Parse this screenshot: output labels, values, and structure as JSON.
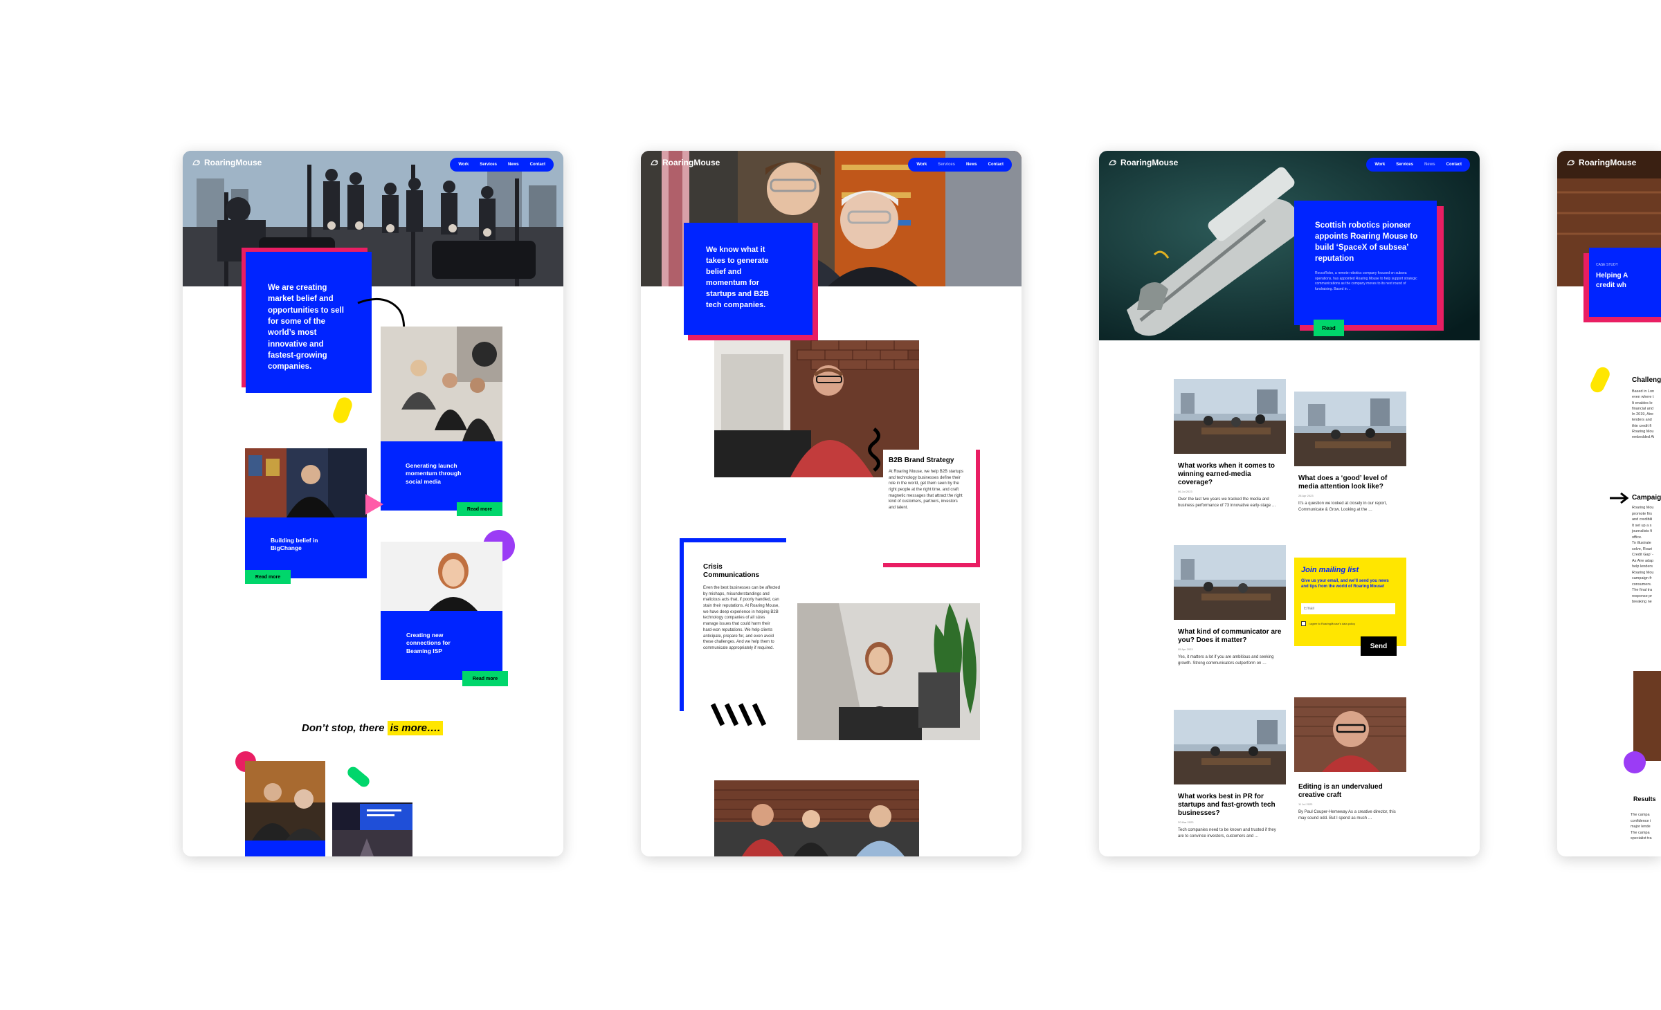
{
  "brand": "RoaringMouse",
  "colors": {
    "blue": "#0024ff",
    "pink": "#e91e63",
    "green": "#00d66b",
    "yellow": "#ffe600",
    "purple": "#9b3cf5"
  },
  "nav": [
    "Work",
    "Services",
    "News",
    "Contact"
  ],
  "card1": {
    "hero_text": "We are creating market belief and opportunities to sell for some of the world’s most innovative and fastest-growing companies.",
    "case1_title": "Generating launch momentum through social media",
    "case2_title": "Building belief in BigChange",
    "case3_title": "Creating new connections for Beaming ISP",
    "read_more": "Read more",
    "more_text_a": "Don’t stop, there ",
    "more_text_b": "is more…."
  },
  "card2": {
    "hero_text": "We know what it takes to generate belief and momentum for startups and B2B tech companies.",
    "service1_title": "B2B Brand Strategy",
    "service1_body": "At Roaring Mouse, we help B2B startups and technology businesses define their role in the world, get them seen by the right people at the right time, and craft magnetic messages that attract the right kind of customers, partners, investors and talent.",
    "service2_title": "Crisis Communications",
    "service2_body": "Even the best businesses can be affected by mishaps, misunderstandings and malicious acts that, if poorly handled, can stain their reputations. At Roaring Mouse, we have deep experience in helping B2B technology companies of all sizes manage issues that could harm their hard-won reputations. We help clients anticipate, prepare for, and even avoid these challenges. And we help them to communicate appropriately if required."
  },
  "card3": {
    "hero_title": "Scottish robotics pioneer appoints Roaring Mouse to build ‘SpaceX of subsea’ reputation",
    "hero_body": "RoccoRobo, a remote robotics company focused on subsea operations, has appointed Roaring Mouse to help support strategic communications as the company moves to its next round of fundraising. Based in…",
    "read": "Read",
    "articles": [
      {
        "title": "What works when it comes to winning earned-media coverage?",
        "date": "06 Jul 2023",
        "body": "Over the last two years we tracked the media and business performance of 73 innovative early-stage …"
      },
      {
        "title": "What does a ‘good’ level of media attention look like?",
        "date": "28 Apr 2023",
        "body": "It’s a question we looked at closely in our report, Communicate & Grow. Looking at the …"
      },
      {
        "title": "What kind of communicator are you? Does it matter?",
        "date": "05 Apr 2023",
        "body": "Yes, it matters a lot if you are ambitious and seeking growth. Strong communicators outperform on …"
      },
      {
        "title": "What works best in PR for startups and fast-growth tech businesses?",
        "date": "20 Mar 2023",
        "body": "Tech companies need to be known and trusted if they are to convince investors, customers and …"
      },
      {
        "title": "Editing is an undervalued creative craft",
        "date": "11 Jul 2023",
        "body": "By Paul Couper-Hemeway As a creative director, this may sound odd. But I spend as much …"
      }
    ],
    "mailing": {
      "title": "Join mailing list",
      "body": "Give us your email, and we’ll send you news and tips from the world of Roaring Mouse!",
      "placeholder": "Email",
      "consent": "I agree to RoaringMouse’s data policy",
      "send": "Send"
    }
  },
  "card4": {
    "case_study": "CASE STUDY",
    "hero_text": "Helping A credit wh",
    "h_challenge": "Challeng",
    "challenge_lines": [
      "Based in Lon",
      "even where t",
      "It enables le",
      "financial and",
      "In 2019, Aire",
      "lenders and",
      "thin credit fi",
      "Roaring Mou",
      "embedded Ai"
    ],
    "h_campaign": "Campaig",
    "campaign_lines": [
      "Roaring Mou",
      "promote firs",
      "and credibili",
      "It set up a s",
      "journalists fi",
      "office.",
      "To illustrate",
      "solve, Roari",
      "Credit Gap' -",
      "As Aire adap",
      "help lenders",
      "Roaring Mou",
      "campaign fr",
      "consumers.",
      "The final tra",
      "response pr",
      "breaking ne"
    ],
    "h_results": "Results",
    "results_lines": [
      "The campa",
      "confidence i",
      "major lende",
      "The campa",
      "specialist tra"
    ]
  }
}
